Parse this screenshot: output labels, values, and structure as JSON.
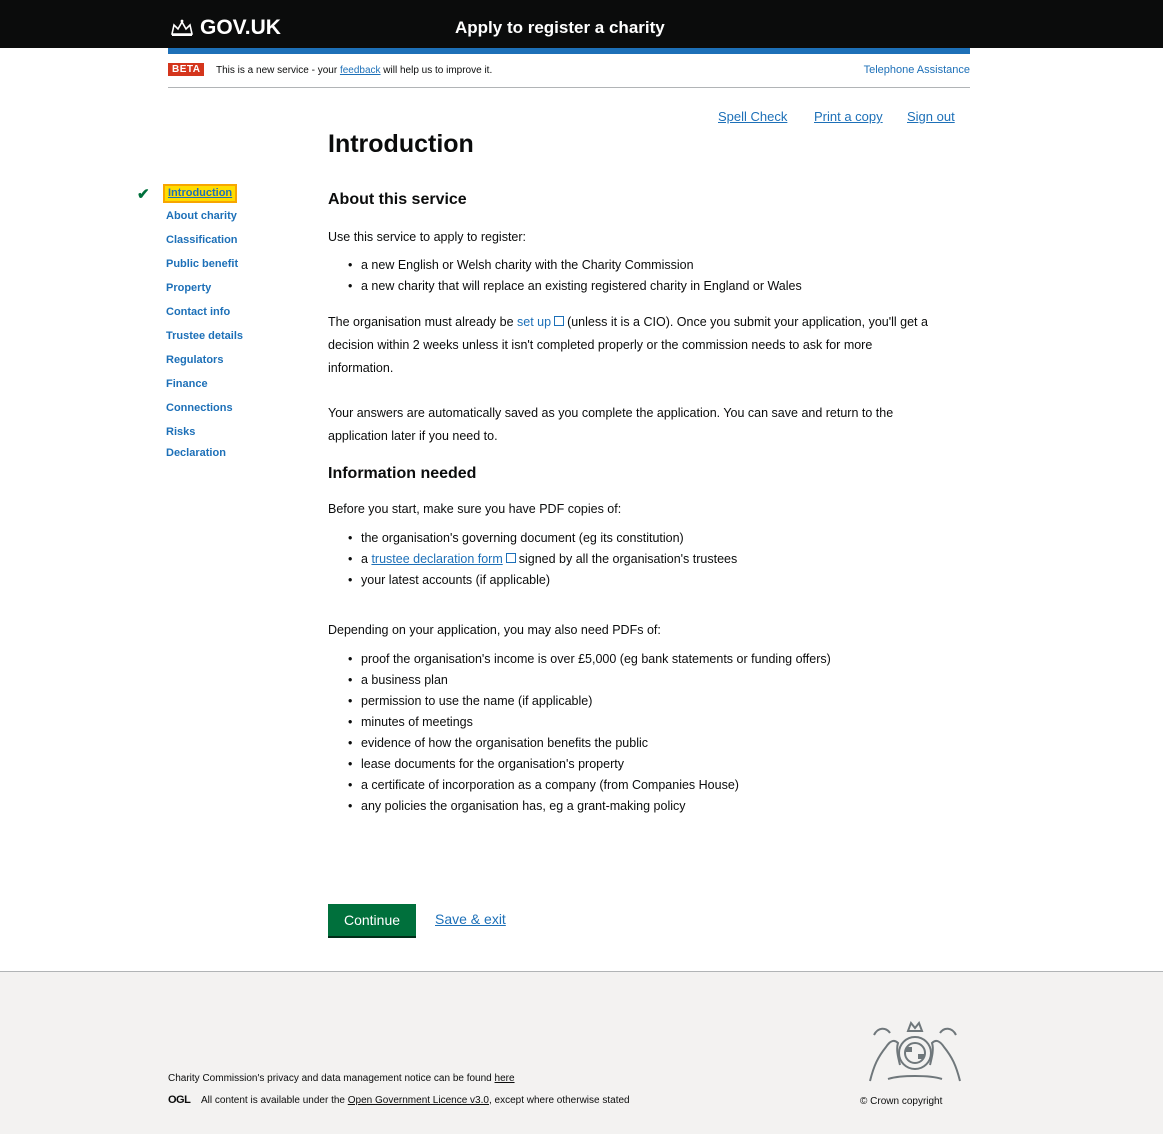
{
  "header": {
    "logo": "GOV.UK",
    "service_name": "Apply to register a charity"
  },
  "phase_banner": {
    "tag": "BETA",
    "text_before": "This is a new service - your ",
    "feedback_link": "feedback",
    "text_after": " will help us to improve it.",
    "telephone": "Telephone Assistance"
  },
  "utility_links": {
    "spell_check": "Spell Check",
    "print": "Print a copy",
    "sign_out": "Sign out"
  },
  "page_title": "Introduction",
  "sidebar": {
    "items": [
      {
        "label": "Introduction",
        "current": true
      },
      {
        "label": "About charity"
      },
      {
        "label": "Classification"
      },
      {
        "label": "Public benefit"
      },
      {
        "label": "Property"
      },
      {
        "label": "Contact info"
      },
      {
        "label": "Trustee details"
      },
      {
        "label": "Regulators"
      },
      {
        "label": "Finance"
      },
      {
        "label": "Connections"
      },
      {
        "label": "Risks"
      },
      {
        "label": "Declaration"
      }
    ]
  },
  "content": {
    "about_heading": "About this service",
    "intro": "Use this service to apply to register:",
    "register_items": [
      "a new English or Welsh charity with the Charity Commission",
      "a new charity that will replace an existing registered charity in England or Wales"
    ],
    "org_para_before": "The organisation must already be ",
    "set_up_link": "set up",
    "org_para_after": "(unless it is a CIO). Once you submit your application, you'll get a decision within 2 weeks unless it isn't completed properly or the commission needs to ask for more information.",
    "saved_para": "Your answers are automatically saved as you complete the application. You can save and return to the application later if you need to.",
    "info_heading": "Information needed",
    "before_start": "Before you start, make sure you have PDF copies of:",
    "pdf_item_1": "the organisation's governing document (eg its constitution)",
    "pdf_item_2_prefix": "a ",
    "pdf_item_2_link": "trustee declaration form",
    "pdf_item_2_suffix": "signed by all the organisation's trustees",
    "pdf_item_3": "your latest accounts (if applicable)",
    "depending": "Depending on your application, you may also need PDFs of:",
    "extra_items": [
      "proof the organisation's income is over £5,000 (eg bank statements or funding offers)",
      "a business plan",
      "permission to use the name (if applicable)",
      "minutes of meetings",
      "evidence of how the organisation benefits the public",
      "lease documents for the organisation's property",
      "a certificate of incorporation as a company (from Companies House)",
      "any policies the organisation has, eg a grant-making policy"
    ]
  },
  "actions": {
    "continue": "Continue",
    "save_exit": "Save & exit"
  },
  "footer": {
    "privacy_text": "Charity Commission's privacy and data management notice can be found ",
    "privacy_link": "here",
    "ogl": "OGL",
    "licence_before": "All content is available under the ",
    "licence_link": "Open Government Licence v3.0",
    "licence_after": ", except where otherwise stated",
    "copyright": "© Crown copyright"
  },
  "colors": {
    "header_bg": "#0b0c0c",
    "link": "#1d70b8",
    "button": "#00703c",
    "beta": "#d4351c",
    "focus": "#ffdd00"
  }
}
